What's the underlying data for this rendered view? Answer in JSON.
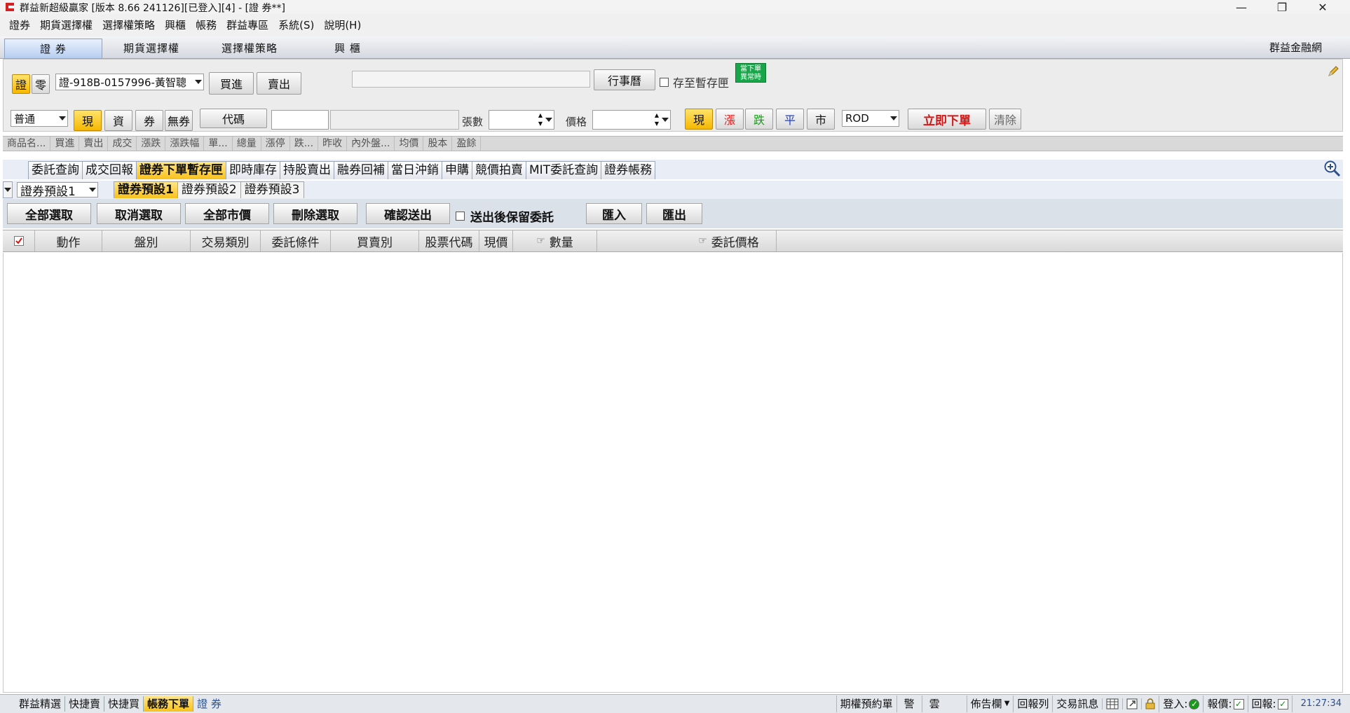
{
  "window": {
    "title": "群益新超級贏家 [版本 8.66 241126][已登入][4] - [證  券**]",
    "minimize_glyph": "—",
    "restore_glyph": "❐",
    "close_glyph": "✕"
  },
  "menu": [
    "證券",
    "期貨選擇權",
    "選擇權策略",
    "興櫃",
    "帳務",
    "群益專區",
    "系統(S)",
    "說明(H)"
  ],
  "module_tabs": {
    "items": [
      "證  券",
      "期貨選擇權",
      "選擇權策略",
      "興  櫃"
    ],
    "active": 0,
    "right_label": "群益金融網"
  },
  "order": {
    "mode_buttons": [
      "證",
      "零"
    ],
    "account": "證-918B-0157996-黃智聰",
    "buy_label": "買進",
    "sell_label": "賣出",
    "calendar_label": "行事曆",
    "save_to_box_label": "存至暫存匣",
    "badge_line1": "當下單",
    "badge_line2": "異常時",
    "order_type": "普通",
    "cash_types": [
      "現",
      "資",
      "券",
      "無券"
    ],
    "code_label": "代碼",
    "qty_label": "張數",
    "price_label": "價格",
    "price_types": [
      "現",
      "漲",
      "跌",
      "平",
      "市"
    ],
    "tif": "ROD",
    "submit_label": "立即下單",
    "clear_label": "清除",
    "colors": {
      "up": "#e02020",
      "down": "#1a9a1a",
      "flat": "#2040c0",
      "submit": "#d01818"
    }
  },
  "quote_headers": [
    "商品名...",
    "買進",
    "賣出",
    "成交",
    "漲跌",
    "漲跌幅",
    "單...",
    "總量",
    "漲停",
    "跌...",
    "昨收",
    "內外盤...",
    "均價",
    "股本",
    "盈餘"
  ],
  "function_tabs": {
    "items": [
      "委託查詢",
      "成交回報",
      "證券下單暫存匣",
      "即時庫存",
      "持股賣出",
      "融券回補",
      "當日沖銷",
      "申購",
      "競價拍賣",
      "MIT委託查詢",
      "證券帳務"
    ],
    "active": 2
  },
  "sub_tabs": {
    "preset_select": "證券預設1",
    "items": [
      "證券預設1",
      "證券預設2",
      "證券預設3"
    ],
    "active": 0
  },
  "actions": {
    "select_all": "全部選取",
    "deselect": "取消選取",
    "all_market": "全部市價",
    "delete_selected": "刪除選取",
    "confirm_send": "確認送出",
    "keep_after_send": "送出後保留委託",
    "import": "匯入",
    "export": "匯出"
  },
  "grid_columns": [
    "動作",
    "盤別",
    "交易類別",
    "委託條件",
    "買賣別",
    "股票代碼",
    "現價",
    "數量",
    "委託價格"
  ],
  "statusbar": {
    "left_tabs": [
      "群益精選",
      "快捷賣",
      "快捷買",
      "帳務下單",
      "證  券"
    ],
    "active": 3,
    "right_items": [
      "期權預約單",
      "警",
      "雲",
      "佈告欄",
      "回報列",
      "交易訊息"
    ],
    "login_label": "登入:",
    "quote_label": "報價:",
    "report_label": "回報:",
    "time": "21:27:34"
  }
}
